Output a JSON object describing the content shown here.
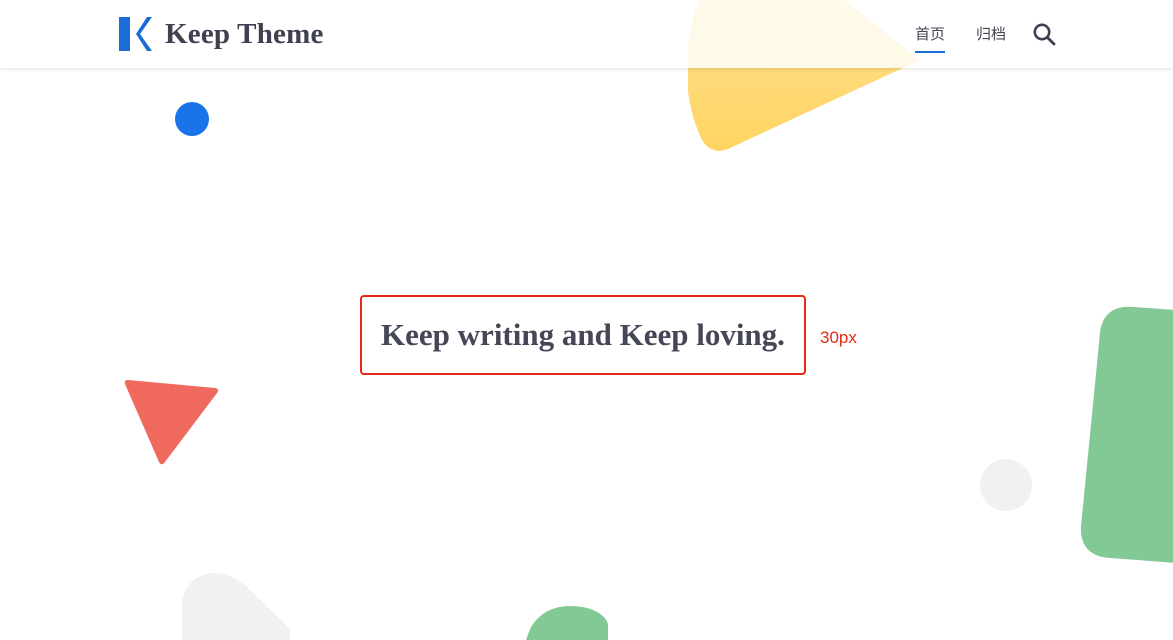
{
  "header": {
    "logo_text": "Keep Theme",
    "nav": [
      {
        "label": "首页",
        "active": true
      },
      {
        "label": "归档",
        "active": false
      }
    ],
    "search_icon": "search-icon"
  },
  "hero": {
    "slogan": "Keep writing and Keep loving.",
    "size_note": "30px"
  },
  "colors": {
    "accent": "#1a6cd8",
    "annotation_red": "#e42a17",
    "text_dark": "#454757",
    "yellow": "#ffd666",
    "green": "#83c996",
    "coral": "#f0695f",
    "grey_shape": "#f0f1f3"
  }
}
